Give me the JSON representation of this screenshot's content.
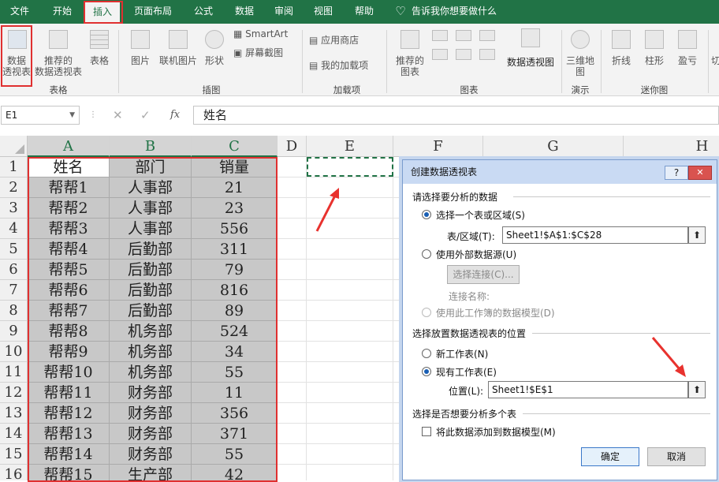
{
  "menu": {
    "tabs": [
      "文件",
      "开始",
      "插入",
      "页面布局",
      "公式",
      "数据",
      "审阅",
      "视图",
      "帮助"
    ],
    "tell_me": "告诉我你想要做什么"
  },
  "ribbon": {
    "pivot_table": [
      "数据",
      "透视表"
    ],
    "recommended_pivot": [
      "推荐的",
      "数据透视表"
    ],
    "table": "表格",
    "group_tables": "表格",
    "picture": "图片",
    "online_picture": "联机图片",
    "shapes": "形状",
    "smartart": "SmartArt",
    "screenshot": "屏幕截图",
    "group_illustrations": "插图",
    "app_store": "应用商店",
    "my_addins": "我的加载项",
    "group_addins": "加载项",
    "recommended_charts": [
      "推荐的",
      "图表"
    ],
    "pivot_chart": "数据透视图",
    "group_charts": "图表",
    "map_3d": [
      "三维地",
      "图"
    ],
    "group_tours": "演示",
    "sparkline_line": "折线",
    "sparkline_column": "柱形",
    "sparkline_winloss": "盈亏",
    "group_sparklines": "迷你图",
    "slicer_cut": "切"
  },
  "formula_bar": {
    "name_box": "E1",
    "fx": "fx",
    "formula": "姓名"
  },
  "sheet": {
    "columns": [
      "A",
      "B",
      "C",
      "D",
      "E",
      "F",
      "G",
      "H"
    ],
    "rows": [
      "1",
      "2",
      "3",
      "4",
      "5",
      "6",
      "7",
      "8",
      "9",
      "10",
      "11",
      "12",
      "13",
      "14",
      "15",
      "16"
    ],
    "table": [
      [
        "姓名",
        "部门",
        "销量"
      ],
      [
        "帮帮1",
        "人事部",
        "21"
      ],
      [
        "帮帮2",
        "人事部",
        "23"
      ],
      [
        "帮帮3",
        "人事部",
        "556"
      ],
      [
        "帮帮4",
        "后勤部",
        "311"
      ],
      [
        "帮帮5",
        "后勤部",
        "79"
      ],
      [
        "帮帮6",
        "后勤部",
        "816"
      ],
      [
        "帮帮7",
        "后勤部",
        "89"
      ],
      [
        "帮帮8",
        "机务部",
        "524"
      ],
      [
        "帮帮9",
        "机务部",
        "34"
      ],
      [
        "帮帮10",
        "机务部",
        "55"
      ],
      [
        "帮帮11",
        "财务部",
        "11"
      ],
      [
        "帮帮12",
        "财务部",
        "356"
      ],
      [
        "帮帮13",
        "财务部",
        "371"
      ],
      [
        "帮帮14",
        "财务部",
        "55"
      ],
      [
        "帮帮15",
        "生产部",
        "42"
      ]
    ]
  },
  "dialog": {
    "title": "创建数据透视表",
    "help": "?",
    "close": "✕",
    "section1": "请选择要分析的数据",
    "opt_select_range": "选择一个表或区域(S)",
    "range_label": "表/区域(T):",
    "range_value": "Sheet1!$A$1:$C$28",
    "opt_external": "使用外部数据源(U)",
    "choose_conn": "选择连接(C)...",
    "conn_name": "连接名称:",
    "opt_data_model": "使用此工作簿的数据模型(D)",
    "section2": "选择放置数据透视表的位置",
    "opt_new_sheet": "新工作表(N)",
    "opt_existing": "现有工作表(E)",
    "location_label": "位置(L):",
    "location_value": "Sheet1!$E$1",
    "section3": "选择是否想要分析多个表",
    "add_model": "将此数据添加到数据模型(M)",
    "ok": "确定",
    "cancel": "取消"
  },
  "colors": {
    "excel_green": "#217346",
    "highlight_red": "#e03030",
    "arrow_red": "#e8322e"
  }
}
